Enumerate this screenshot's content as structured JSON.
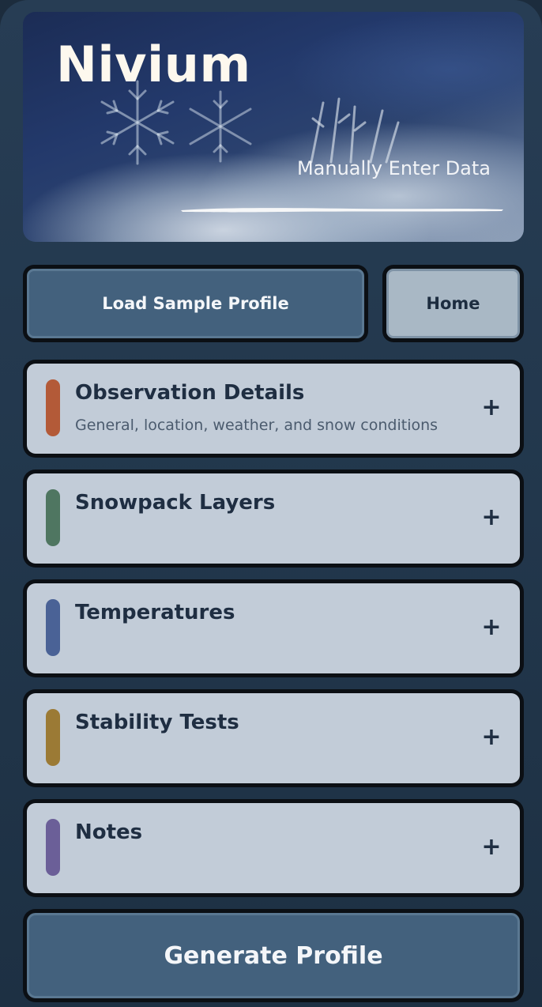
{
  "header": {
    "app_title": "Nivium",
    "subtitle": "Manually Enter Data"
  },
  "actions": {
    "load_sample_label": "Load Sample Profile",
    "home_label": "Home",
    "generate_label": "Generate Profile"
  },
  "sections": [
    {
      "title": "Observation Details",
      "description": "General, location, weather, and snow conditions",
      "accent_color": "#b35a38",
      "icon": "plus-icon",
      "toggle_symbol": "+"
    },
    {
      "title": "Snowpack Layers",
      "description": "",
      "accent_color": "#4f7661",
      "icon": "plus-icon",
      "toggle_symbol": "+"
    },
    {
      "title": "Temperatures",
      "description": "",
      "accent_color": "#4a6296",
      "icon": "plus-icon",
      "toggle_symbol": "+"
    },
    {
      "title": "Stability Tests",
      "description": "",
      "accent_color": "#9b7a35",
      "icon": "plus-icon",
      "toggle_symbol": "+"
    },
    {
      "title": "Notes",
      "description": "",
      "accent_color": "#6b5f98",
      "icon": "plus-icon",
      "toggle_symbol": "+"
    }
  ]
}
